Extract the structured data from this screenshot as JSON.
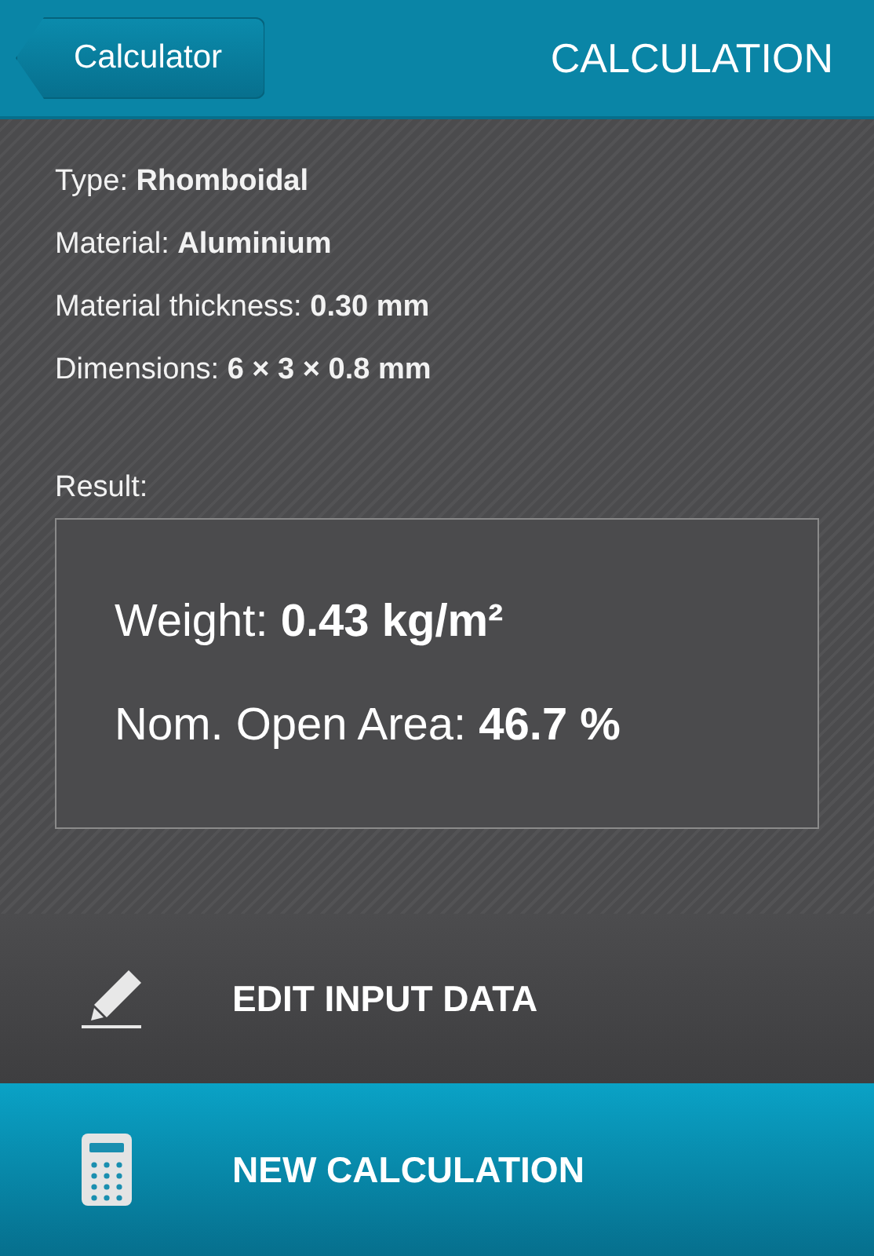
{
  "header": {
    "back_button": "Calculator",
    "title": "CALCULATION"
  },
  "details": [
    "Type: **Rhomboidal**",
    "Material: **Aluminium**",
    "Material thickness: **0.30 mm**",
    "Dimensions: **6 × 3 × 0.8 mm**"
  ],
  "result": {
    "label": "Result:",
    "lines": [
      "Weight: **0.43 kg/m²**",
      "Nom. Open Area: **46.7 %**"
    ]
  },
  "actions": [
    {
      "kind": "edit",
      "label": "EDIT INPUT DATA"
    },
    {
      "kind": "new",
      "label": "NEW CALCULATION"
    }
  ]
}
